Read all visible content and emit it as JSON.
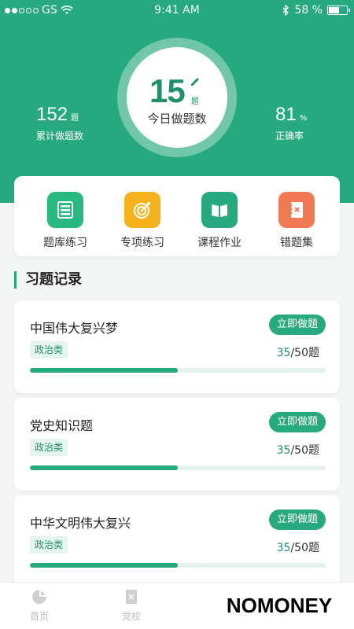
{
  "status_bar": {
    "carrier": "GS",
    "time": "9:41 AM",
    "battery": "58 %",
    "battery_level": 0.58
  },
  "hero": {
    "today_count": "15",
    "today_unit": "题",
    "today_label": "今日做题数",
    "total_count": "152",
    "total_unit": "题",
    "total_label": "累计做题数",
    "accuracy": "81",
    "accuracy_unit": "%",
    "accuracy_label": "正确率"
  },
  "menu": {
    "items": [
      {
        "label": "题库练习",
        "icon": "question-bank-icon",
        "color": "#27b97f"
      },
      {
        "label": "专项练习",
        "icon": "target-icon",
        "color": "#f5b21a"
      },
      {
        "label": "课程作业",
        "icon": "book-icon",
        "color": "#27a97f"
      },
      {
        "label": "错题集",
        "icon": "wrong-notebook-icon",
        "color": "#f27a52"
      }
    ]
  },
  "section": {
    "title": "习题记录"
  },
  "records": [
    {
      "title": "中国伟大复兴梦",
      "button": "立即做题",
      "tag": "政治类",
      "done": "35",
      "total": "/50题",
      "fraction": 0.5
    },
    {
      "title": "党史知识题",
      "button": "立即做题",
      "tag": "政治类",
      "done": "35",
      "total": "/50题",
      "fraction": 0.5
    },
    {
      "title": "中华文明伟大复兴",
      "button": "立即做题",
      "tag": "政治类",
      "done": "35",
      "total": "/50题",
      "fraction": 0.5
    }
  ],
  "tabbar": {
    "items": [
      {
        "label": "首页",
        "icon": "home-icon"
      },
      {
        "label": "党校",
        "icon": "party-school-icon"
      }
    ]
  },
  "brand": {
    "text": "NOMONEY"
  },
  "colors": {
    "primary": "#27a97f",
    "primary_dark": "#1e8f6b",
    "orange": "#f5b21a",
    "coral": "#f27a52"
  }
}
